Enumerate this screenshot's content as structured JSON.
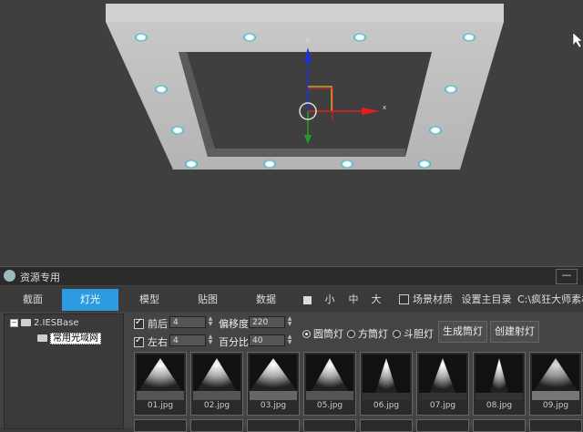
{
  "window": {
    "title": "资源专用",
    "minimize_label": "—"
  },
  "tabs": [
    {
      "label": "截面",
      "active": false
    },
    {
      "label": "灯光",
      "active": true
    },
    {
      "label": "模型",
      "active": false
    },
    {
      "label": "贴图",
      "active": false
    },
    {
      "label": "数据",
      "active": false
    }
  ],
  "size_options": [
    "小",
    "中",
    "大"
  ],
  "toolbar": {
    "scene_material_label": "场景材质",
    "scene_material_checked": false,
    "set_root_label": "设置主目录",
    "path_text": "C:\\疯狂大师素材"
  },
  "tree": {
    "root_label": "2.IESBase",
    "child_label": "常用光域网"
  },
  "controls": {
    "front_back_label": "前后",
    "front_back_checked": true,
    "front_back_value": "4",
    "offset_label": "偏移度",
    "offset_value": "220",
    "left_right_label": "左右",
    "left_right_checked": true,
    "left_right_value": "4",
    "percent_label": "百分比",
    "percent_value": "40"
  },
  "light_types": [
    {
      "label": "圆筒灯",
      "selected": true
    },
    {
      "label": "方筒灯",
      "selected": false
    },
    {
      "label": "斗胆灯",
      "selected": false
    }
  ],
  "buttons": {
    "generate_label": "生成筒灯",
    "create_label": "创建射灯"
  },
  "thumbnails": [
    {
      "caption": "01.jpg"
    },
    {
      "caption": "02.jpg"
    },
    {
      "caption": "03.jpg"
    },
    {
      "caption": "05.jpg"
    },
    {
      "caption": "06.jpg"
    },
    {
      "caption": "07.jpg"
    },
    {
      "caption": "08.jpg"
    },
    {
      "caption": "09.jpg"
    }
  ],
  "colors": {
    "accent": "#2d9be0",
    "gizmo_x": "#e02020",
    "gizmo_y": "#20a020",
    "gizmo_z": "#2020e0",
    "gizmo_yellow": "#f0e020"
  }
}
